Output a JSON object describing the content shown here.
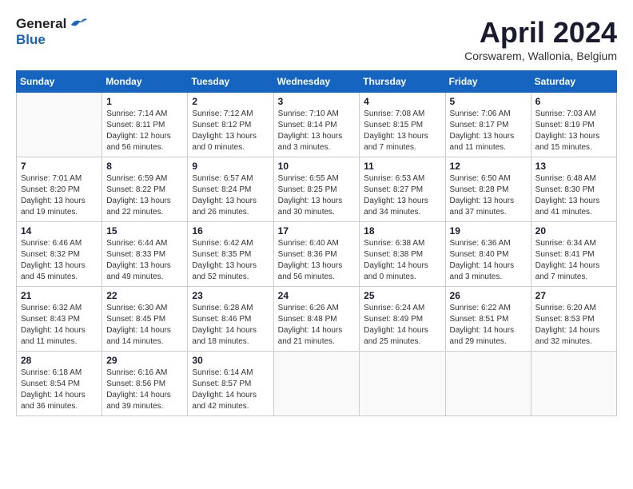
{
  "header": {
    "logo_general": "General",
    "logo_blue": "Blue",
    "title": "April 2024",
    "location": "Corswarem, Wallonia, Belgium"
  },
  "calendar": {
    "days_of_week": [
      "Sunday",
      "Monday",
      "Tuesday",
      "Wednesday",
      "Thursday",
      "Friday",
      "Saturday"
    ],
    "weeks": [
      [
        {
          "day": "",
          "info": ""
        },
        {
          "day": "1",
          "info": "Sunrise: 7:14 AM\nSunset: 8:11 PM\nDaylight: 12 hours\nand 56 minutes."
        },
        {
          "day": "2",
          "info": "Sunrise: 7:12 AM\nSunset: 8:12 PM\nDaylight: 13 hours\nand 0 minutes."
        },
        {
          "day": "3",
          "info": "Sunrise: 7:10 AM\nSunset: 8:14 PM\nDaylight: 13 hours\nand 3 minutes."
        },
        {
          "day": "4",
          "info": "Sunrise: 7:08 AM\nSunset: 8:15 PM\nDaylight: 13 hours\nand 7 minutes."
        },
        {
          "day": "5",
          "info": "Sunrise: 7:06 AM\nSunset: 8:17 PM\nDaylight: 13 hours\nand 11 minutes."
        },
        {
          "day": "6",
          "info": "Sunrise: 7:03 AM\nSunset: 8:19 PM\nDaylight: 13 hours\nand 15 minutes."
        }
      ],
      [
        {
          "day": "7",
          "info": "Sunrise: 7:01 AM\nSunset: 8:20 PM\nDaylight: 13 hours\nand 19 minutes."
        },
        {
          "day": "8",
          "info": "Sunrise: 6:59 AM\nSunset: 8:22 PM\nDaylight: 13 hours\nand 22 minutes."
        },
        {
          "day": "9",
          "info": "Sunrise: 6:57 AM\nSunset: 8:24 PM\nDaylight: 13 hours\nand 26 minutes."
        },
        {
          "day": "10",
          "info": "Sunrise: 6:55 AM\nSunset: 8:25 PM\nDaylight: 13 hours\nand 30 minutes."
        },
        {
          "day": "11",
          "info": "Sunrise: 6:53 AM\nSunset: 8:27 PM\nDaylight: 13 hours\nand 34 minutes."
        },
        {
          "day": "12",
          "info": "Sunrise: 6:50 AM\nSunset: 8:28 PM\nDaylight: 13 hours\nand 37 minutes."
        },
        {
          "day": "13",
          "info": "Sunrise: 6:48 AM\nSunset: 8:30 PM\nDaylight: 13 hours\nand 41 minutes."
        }
      ],
      [
        {
          "day": "14",
          "info": "Sunrise: 6:46 AM\nSunset: 8:32 PM\nDaylight: 13 hours\nand 45 minutes."
        },
        {
          "day": "15",
          "info": "Sunrise: 6:44 AM\nSunset: 8:33 PM\nDaylight: 13 hours\nand 49 minutes."
        },
        {
          "day": "16",
          "info": "Sunrise: 6:42 AM\nSunset: 8:35 PM\nDaylight: 13 hours\nand 52 minutes."
        },
        {
          "day": "17",
          "info": "Sunrise: 6:40 AM\nSunset: 8:36 PM\nDaylight: 13 hours\nand 56 minutes."
        },
        {
          "day": "18",
          "info": "Sunrise: 6:38 AM\nSunset: 8:38 PM\nDaylight: 14 hours\nand 0 minutes."
        },
        {
          "day": "19",
          "info": "Sunrise: 6:36 AM\nSunset: 8:40 PM\nDaylight: 14 hours\nand 3 minutes."
        },
        {
          "day": "20",
          "info": "Sunrise: 6:34 AM\nSunset: 8:41 PM\nDaylight: 14 hours\nand 7 minutes."
        }
      ],
      [
        {
          "day": "21",
          "info": "Sunrise: 6:32 AM\nSunset: 8:43 PM\nDaylight: 14 hours\nand 11 minutes."
        },
        {
          "day": "22",
          "info": "Sunrise: 6:30 AM\nSunset: 8:45 PM\nDaylight: 14 hours\nand 14 minutes."
        },
        {
          "day": "23",
          "info": "Sunrise: 6:28 AM\nSunset: 8:46 PM\nDaylight: 14 hours\nand 18 minutes."
        },
        {
          "day": "24",
          "info": "Sunrise: 6:26 AM\nSunset: 8:48 PM\nDaylight: 14 hours\nand 21 minutes."
        },
        {
          "day": "25",
          "info": "Sunrise: 6:24 AM\nSunset: 8:49 PM\nDaylight: 14 hours\nand 25 minutes."
        },
        {
          "day": "26",
          "info": "Sunrise: 6:22 AM\nSunset: 8:51 PM\nDaylight: 14 hours\nand 29 minutes."
        },
        {
          "day": "27",
          "info": "Sunrise: 6:20 AM\nSunset: 8:53 PM\nDaylight: 14 hours\nand 32 minutes."
        }
      ],
      [
        {
          "day": "28",
          "info": "Sunrise: 6:18 AM\nSunset: 8:54 PM\nDaylight: 14 hours\nand 36 minutes."
        },
        {
          "day": "29",
          "info": "Sunrise: 6:16 AM\nSunset: 8:56 PM\nDaylight: 14 hours\nand 39 minutes."
        },
        {
          "day": "30",
          "info": "Sunrise: 6:14 AM\nSunset: 8:57 PM\nDaylight: 14 hours\nand 42 minutes."
        },
        {
          "day": "",
          "info": ""
        },
        {
          "day": "",
          "info": ""
        },
        {
          "day": "",
          "info": ""
        },
        {
          "day": "",
          "info": ""
        }
      ]
    ]
  }
}
